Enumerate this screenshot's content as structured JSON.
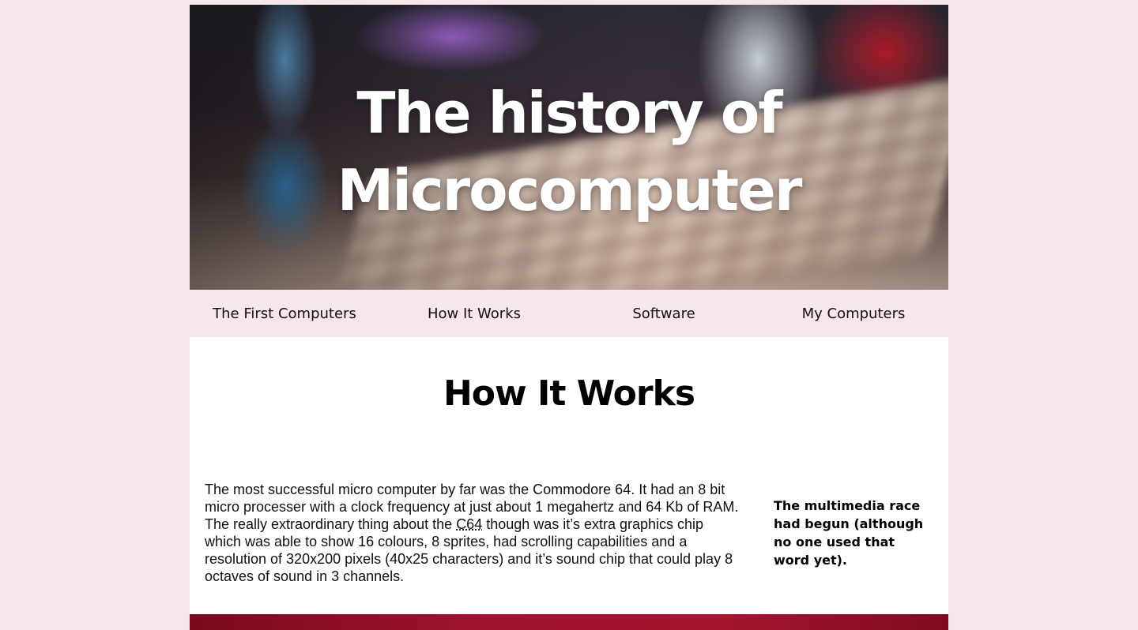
{
  "hero": {
    "title_line1": "The history of",
    "title_line2": "Microcomputer"
  },
  "nav": {
    "items": [
      {
        "label": "The First Computers"
      },
      {
        "label": "How It Works"
      },
      {
        "label": "Software"
      },
      {
        "label": "My Computers"
      }
    ]
  },
  "main": {
    "title": "How It Works",
    "body_part1": "The most successful micro computer by far was the Commodore 64. It had an 8 bit micro processer with a clock frequency at just about 1 megahertz and 64 Kb of RAM. The really extraordinary thing about the ",
    "abbr": "C64",
    "body_part2": " though was it’s extra graphics chip which was able to show 16 colours, 8 sprites, had scrolling capabilities and a resolution of 320x200 pixels (40x25 characters) and it’s sound chip that could play 8 octaves of sound in 3 channels.",
    "aside": "The multimedia race had begun (although no one used that word yet)."
  },
  "colors": {
    "page_background": "#f7e6eb",
    "content_background": "#ffffff",
    "hero_title": "#ffffff",
    "footer_image_accent": "#9e1330"
  }
}
